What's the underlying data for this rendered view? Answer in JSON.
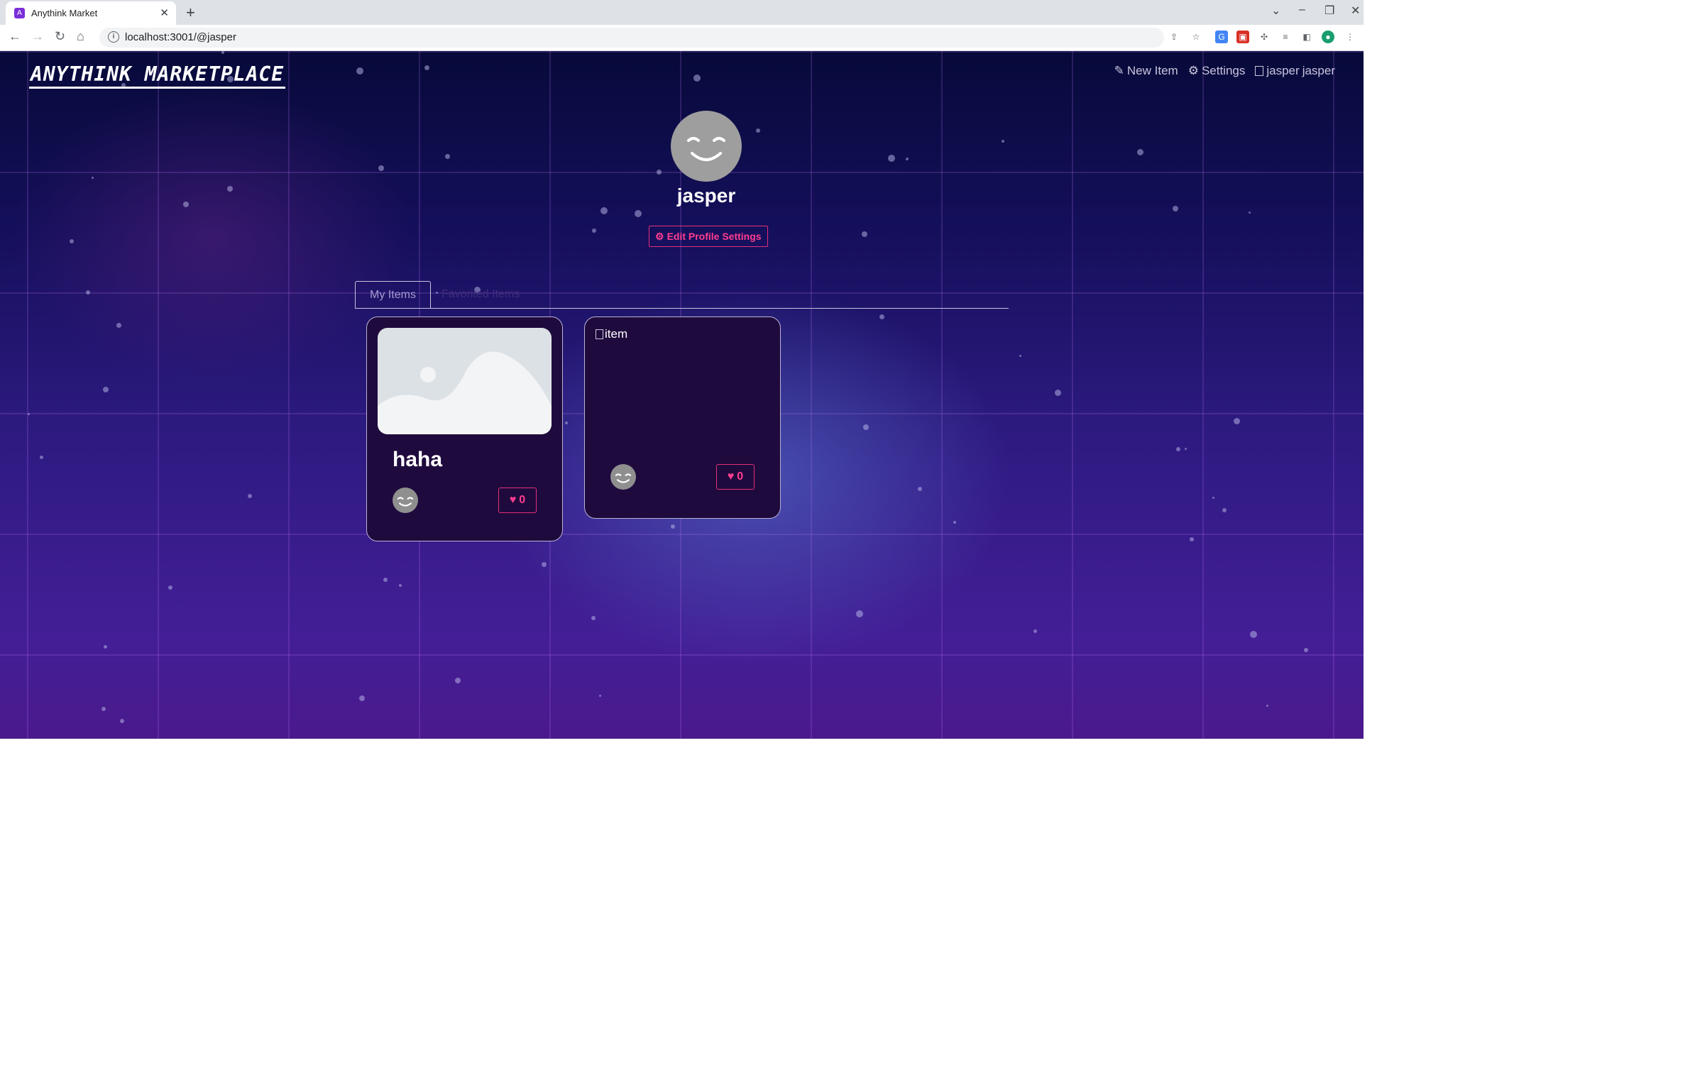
{
  "browser": {
    "tab_title": "Anythink Market",
    "url": "localhost:3001/@jasper"
  },
  "header": {
    "logo": "ANYTHINK MARKETPLACE",
    "nav": {
      "new_item": "New Item",
      "settings": "Settings",
      "user_alt": "jasper",
      "user_name": "jasper"
    }
  },
  "profile": {
    "username": "jasper",
    "edit_button": "Edit Profile Settings"
  },
  "tabs": {
    "my_items": "My Items",
    "favorited_items": "Favorited Items"
  },
  "items": [
    {
      "title": "haha",
      "favorites": "0",
      "image_state": "placeholder"
    },
    {
      "title": "",
      "favorites": "0",
      "image_alt": "item",
      "image_state": "broken"
    }
  ]
}
